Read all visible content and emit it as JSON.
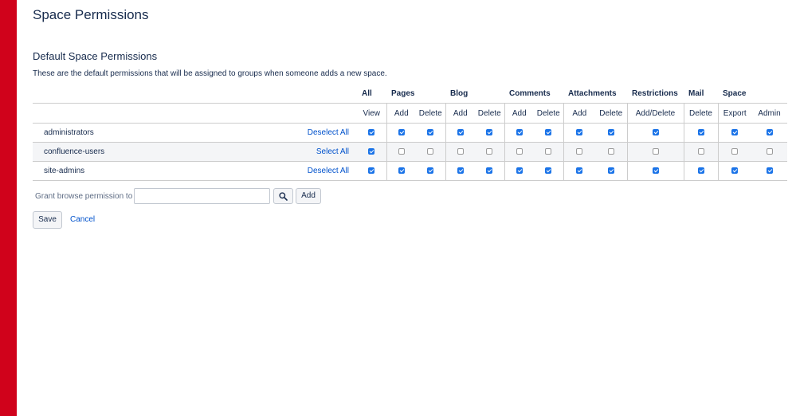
{
  "page_title": "Space Permissions",
  "section_title": "Default Space Permissions",
  "description": "These are the default permissions that will be assigned to groups when someone adds a new space.",
  "groups": [
    "All",
    "Pages",
    "Blog",
    "Comments",
    "Attachments",
    "Restrictions",
    "Mail",
    "Space"
  ],
  "columns": [
    "View",
    "Add",
    "Delete",
    "Add",
    "Delete",
    "Add",
    "Delete",
    "Add",
    "Delete",
    "Add/Delete",
    "Delete",
    "Export",
    "Admin"
  ],
  "rows": [
    {
      "name": "administrators",
      "action": "Deselect All",
      "perms": [
        true,
        true,
        true,
        true,
        true,
        true,
        true,
        true,
        true,
        true,
        true,
        true,
        true
      ]
    },
    {
      "name": "confluence-users",
      "action": "Select All",
      "perms": [
        true,
        false,
        false,
        false,
        false,
        false,
        false,
        false,
        false,
        false,
        false,
        false,
        false
      ]
    },
    {
      "name": "site-admins",
      "action": "Deselect All",
      "perms": [
        true,
        true,
        true,
        true,
        true,
        true,
        true,
        true,
        true,
        true,
        true,
        true,
        true
      ]
    }
  ],
  "grant": {
    "label": "Grant browse permission to",
    "input_value": "",
    "search_icon": "search-icon",
    "add_label": "Add"
  },
  "buttons": {
    "save_label": "Save",
    "cancel_label": "Cancel"
  },
  "colors": {
    "sidebar_accent": "#d0021b",
    "link": "#0052cc",
    "checkbox_checked": "#1a73e8"
  }
}
